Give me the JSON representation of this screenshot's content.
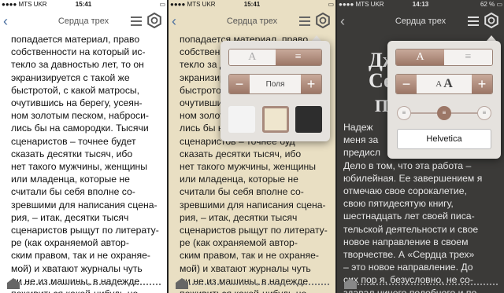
{
  "status": {
    "carrier": "●●●● MTS UKR",
    "time_1": "15:41",
    "time_2": "15:41",
    "time_3": "14:13",
    "battery_1": "▭",
    "battery_2": "▭",
    "battery_3": "62 % ▭"
  },
  "nav": {
    "title": "Сердца трех",
    "back_icon": "‹"
  },
  "page1": {
    "lines": [
      "попадается материал, право",
      "собственности на который ис-",
      "текло за давностью лет, то он",
      "экранизируется с такой же",
      "быстротой, с какой матросы,",
      "очутившись на берегу, усеян-",
      "ном золотым песком, наброси-",
      "лись бы на самородки. Тысячи",
      "сценаристов – точнее будет",
      "сказать десятки тысяч, ибо",
      "нет такого мужчины, женщины",
      "или младенца, которые не",
      "считали бы себя вполне со-",
      "зревшими для написания сцена-",
      "рия, – итак, десятки тысяч",
      "сценаристов рыщут по литерату-",
      "ре (как охраняемой автор-",
      "ским правом, так и не охраняе-",
      "мой) и хватают журналы чуть",
      "ли не из машины, в надежде",
      "поживиться какой-нибудь но-"
    ]
  },
  "page2": {
    "lines": [
      "попадается материал, право",
      "собственности на который",
      "текло за давностью лет, то",
      "экранизируется с такой же",
      "быстротой, с какой матрос",
      "очутившись на берегу, уся",
      "ном золотым песком, наб",
      "лись бы на самородки. Ты",
      "сценаристов – точнее буд",
      "сказать десятки тысяч, ибо",
      "нет такого мужчины, женщины",
      "или младенца, которые не",
      "считали бы себя вполне со-",
      "зревшими для написания сцена-",
      "рия, – итак, десятки тысяч",
      "сценаристов рыщут по литерату-",
      "ре (как охраняемой автор-",
      "ским правом, так и не охраняе-",
      "мой) и хватают журналы чуть",
      "ли не из машины, в надежде",
      "поживиться какой-нибудь но-"
    ],
    "margins_label": "Поля",
    "minus": "−",
    "plus": "+"
  },
  "page3": {
    "heading1": "Дж",
    "heading2": "Се",
    "heading3": "Пр",
    "lines": [
      "Надеж",
      "меня за",
      "предисл",
      "Дело в том, что эта работа –",
      "юбилейная. Ее завершением я",
      "отмечаю свое сорокалетие,",
      "свою пятидесятую книгу,",
      "шестнадцать лет своей писа-",
      "тельской деятельности и свое",
      "новое направление в своем",
      "творчестве. А «Сердца трех»",
      "– это новое направление. До",
      "сих пор я, безусловно, не со-",
      "здавал ничего подобного и по-"
    ],
    "font_small": "A",
    "font_large": "A",
    "font_name": "Helvetica",
    "minus": "−",
    "plus": "+"
  },
  "seg": {
    "serif_letter": "A",
    "justify_icon": "≡"
  },
  "colors": {
    "sepia": "#e9dfc3",
    "dark": "#3b3a38",
    "accent": "#9c7767"
  }
}
